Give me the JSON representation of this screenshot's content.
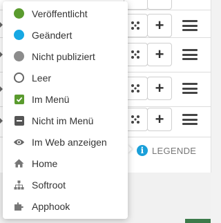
{
  "legend_button": {
    "label": "LEGENDE",
    "icon": "info-icon",
    "color": "#1a9fd9"
  },
  "legend_items": [
    {
      "label": "Veröffentlicht",
      "icon": "published-dot-icon",
      "color": "#5a9b2e"
    },
    {
      "label": "Geändert",
      "icon": "changed-dot-icon",
      "color": "#17a8e3"
    },
    {
      "label": "Nicht publiziert",
      "icon": "unpublished-dot-icon",
      "color": "#8c8c8c"
    },
    {
      "label": "Leer",
      "icon": "empty-circle-icon",
      "color": "#666666"
    },
    {
      "label": "Im Menü",
      "icon": "checkbox-checked-icon",
      "color": "#5a9b2e"
    },
    {
      "label": "Nicht im Menü",
      "icon": "checkbox-minus-icon",
      "color": "#555555"
    },
    {
      "label": "Im Web anzeigen",
      "icon": "eye-icon",
      "color": "#666666"
    },
    {
      "label": "Home",
      "icon": "home-icon",
      "color": "#777777"
    },
    {
      "label": "Softroot",
      "icon": "sitemap-icon",
      "color": "#777777"
    },
    {
      "label": "Apphook",
      "icon": "puzzle-icon",
      "color": "#777777"
    }
  ],
  "row_actions": {
    "structure_icon": "structure-icon",
    "add_label": "+",
    "menu_icon": "hamburger-icon"
  }
}
